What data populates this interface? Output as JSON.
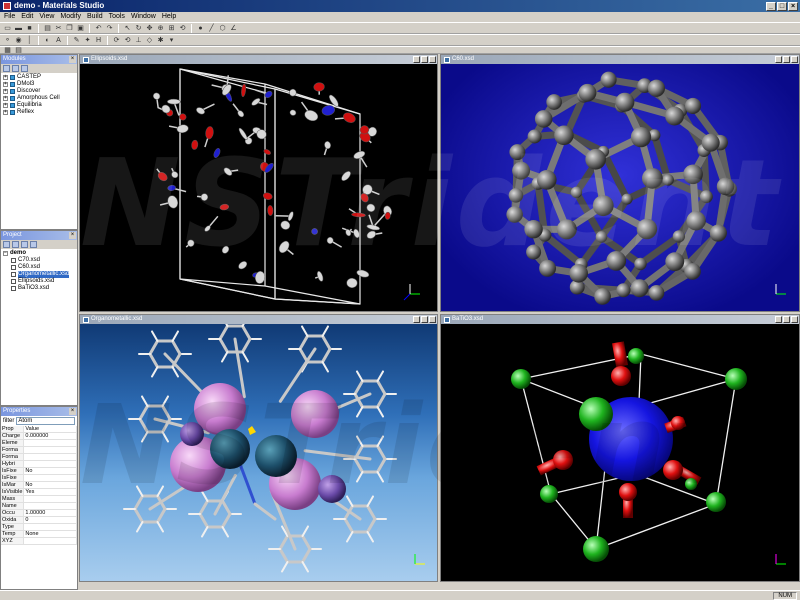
{
  "window": {
    "title": "demo - Materials Studio"
  },
  "menu": [
    "File",
    "Edit",
    "View",
    "Modify",
    "Build",
    "Tools",
    "Window",
    "Help"
  ],
  "modules_panel": {
    "title": "Modules",
    "items": [
      "CASTEP",
      "DMol3",
      "Discover",
      "Amorphous Cell",
      "Equilibria",
      "Reflex"
    ]
  },
  "project_panel": {
    "title": "Project",
    "root": "demo",
    "files": [
      "C70.xsd",
      "C60.xsd",
      "Organometallic.xsd",
      "Ellipsoids.xsd",
      "BaTiO3.xsd"
    ],
    "selected_index": 2
  },
  "properties_panel": {
    "title": "Properties",
    "filter_label": "filter",
    "filter_value": "Atom",
    "columns": [
      "Prop",
      "Value"
    ],
    "rows": [
      [
        "Charge",
        "0.000000"
      ],
      [
        "Eleme",
        ""
      ],
      [
        "Forma",
        ""
      ],
      [
        "Forma",
        ""
      ],
      [
        "Hybri",
        ""
      ],
      [
        "IsFixe",
        "No"
      ],
      [
        "IsFixe",
        ""
      ],
      [
        "IsMar",
        "No"
      ],
      [
        "IsVisible",
        "Yes"
      ],
      [
        "Mass",
        ""
      ],
      [
        "Name",
        ""
      ],
      [
        "Occu",
        "1.00000"
      ],
      [
        "Oxida",
        "0"
      ],
      [
        "Type",
        ""
      ],
      [
        "Temp",
        "None"
      ],
      [
        "XYZ",
        ""
      ]
    ]
  },
  "documents": [
    {
      "title": "Ellipsoids.xsd",
      "bg": "#000000"
    },
    {
      "title": "C60.xsd",
      "bg": "#1a1ab8"
    },
    {
      "title": "Organometallic.xsd",
      "bg": "#0d3f7a"
    },
    {
      "title": "BaTiO3.xsd",
      "bg": "#000000"
    }
  ],
  "watermark": {
    "line1": "NSTrident",
    "line2": "NSTrident"
  },
  "status": {
    "right": "NUM"
  },
  "colors": {
    "title_bar": "#0a246a",
    "chrome": "#d4d0c8",
    "selection": "#316ac5"
  },
  "icons": [
    "new-file-icon",
    "open-folder-icon",
    "save-icon",
    "print-icon",
    "undo-icon",
    "redo-icon",
    "rotate-icon",
    "zoom-icon",
    "select-icon"
  ]
}
